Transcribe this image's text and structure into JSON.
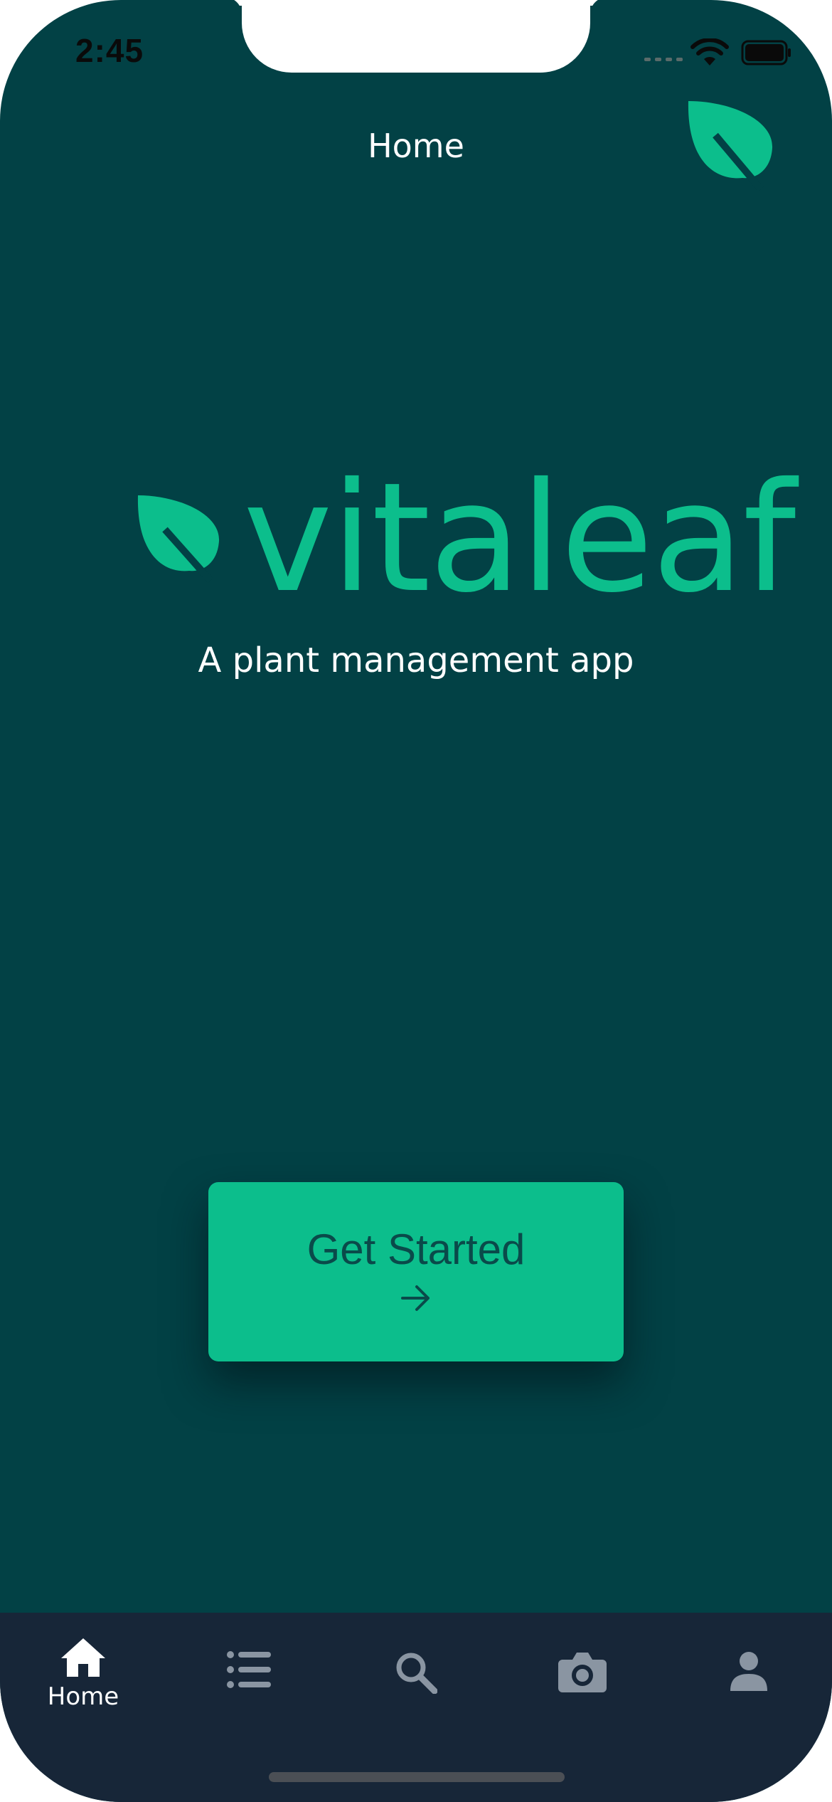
{
  "status_bar": {
    "time": "2:45"
  },
  "header": {
    "title": "Home",
    "logo_icon": "leaf-icon"
  },
  "brand": {
    "name": "vitaleaf",
    "tagline": "A plant management app",
    "accent_color": "#0cbe8c",
    "background_color": "#024145"
  },
  "main": {
    "cta_label": "Get Started",
    "cta_icon": "arrow-right-icon"
  },
  "tab_bar": {
    "background_color": "#172638",
    "tabs": [
      {
        "id": "home",
        "label": "Home",
        "icon": "home-icon",
        "active": true
      },
      {
        "id": "list",
        "icon": "list-icon",
        "active": false
      },
      {
        "id": "search",
        "icon": "search-icon",
        "active": false
      },
      {
        "id": "camera",
        "icon": "camera-icon",
        "active": false
      },
      {
        "id": "profile",
        "icon": "user-icon",
        "active": false
      }
    ]
  }
}
